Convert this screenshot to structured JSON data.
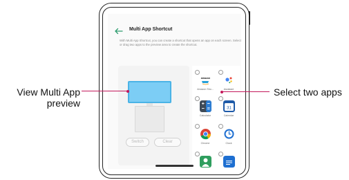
{
  "screen": {
    "title": "Multi App Shortcut",
    "description": "With Multi App Shortcut, you can create a shortcut that opens an app on each screen. Select or drag two apps to the preview area to create the shortcut."
  },
  "preview": {
    "switch_label": "Switch",
    "clear_label": "Clear"
  },
  "apps": [
    {
      "label": "Amazon Sho...",
      "icon": "amazon-icon"
    },
    {
      "label": "Assistant",
      "icon": "assistant-icon"
    },
    {
      "label": "Calculator",
      "icon": "calculator-icon"
    },
    {
      "label": "Calendar",
      "icon": "calendar-icon"
    },
    {
      "label": "Chrome",
      "icon": "chrome-icon"
    },
    {
      "label": "Clock",
      "icon": "clock-icon"
    },
    {
      "label": "",
      "icon": "contacts-icon"
    },
    {
      "label": "",
      "icon": "docs-icon"
    }
  ],
  "calendar_day": "31",
  "amazon_text": "amazon",
  "callouts": {
    "left": [
      "View Multi App",
      "preview"
    ],
    "right": "Select two apps"
  },
  "colors": {
    "accent": "#c3185b",
    "preview_top": "#7ccdf5",
    "back_arrow": "#2c9c6e"
  }
}
